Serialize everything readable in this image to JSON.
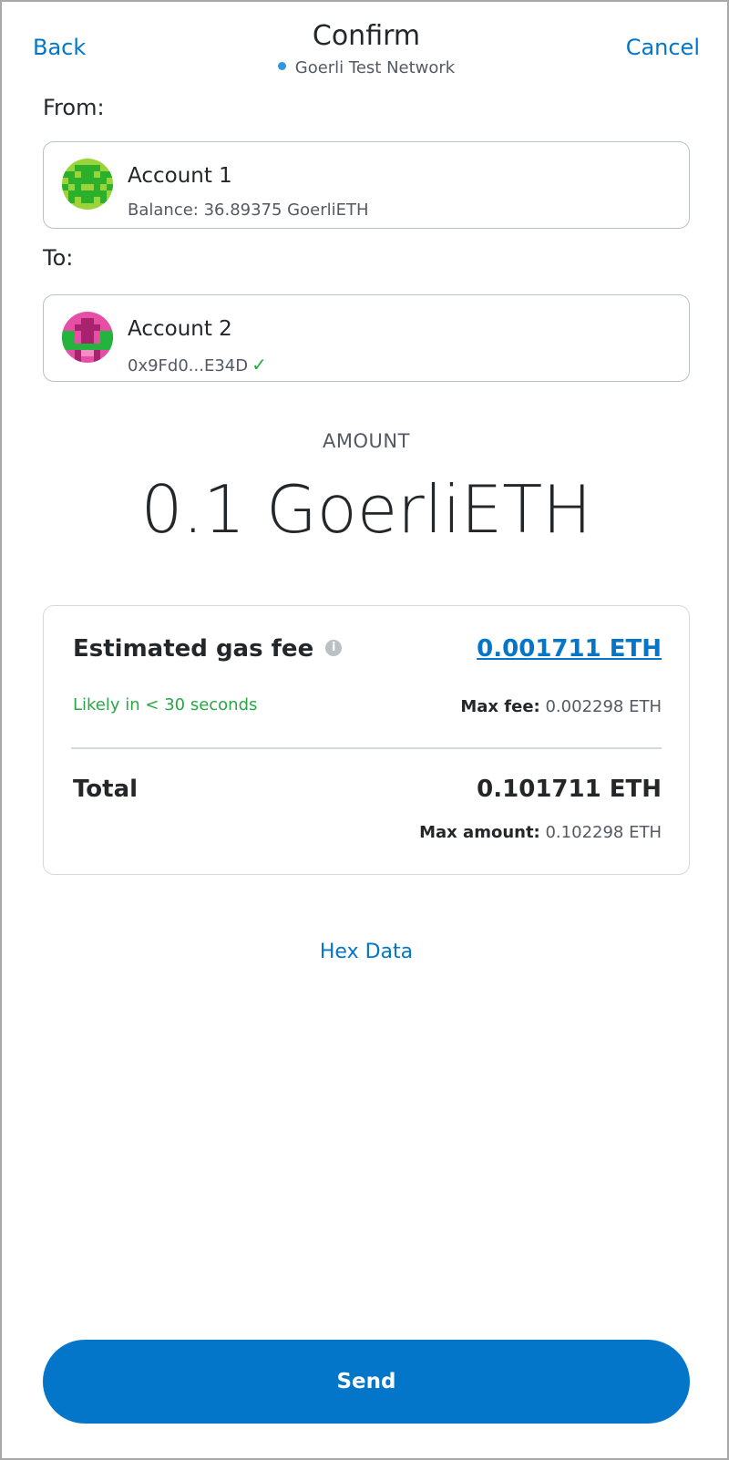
{
  "header": {
    "back_label": "Back",
    "title": "Confirm",
    "network": "Goerli Test Network",
    "cancel_label": "Cancel",
    "network_dot_color": "#3098dc"
  },
  "from": {
    "label": "From:",
    "account_name": "Account 1",
    "balance": "Balance: 36.89375 GoerliETH",
    "avatar": "identicon-green"
  },
  "to": {
    "label": "To:",
    "account_name": "Account 2",
    "address": "0x9Fd0...E34D",
    "verified_icon": "checkmark-icon",
    "avatar": "identicon-pink"
  },
  "amount": {
    "label": "AMOUNT",
    "value": "0.1 GoerliETH"
  },
  "fee": {
    "gas_label": "Estimated gas fee",
    "gas_value": "0.001711 ETH",
    "likely": "Likely in < 30 seconds",
    "max_fee_label": "Max fee:",
    "max_fee_value": "0.002298 ETH",
    "total_label": "Total",
    "total_value": "0.101711 ETH",
    "max_amount_label": "Max amount:",
    "max_amount_value": "0.102298 ETH"
  },
  "hex_data_label": "Hex Data",
  "send_label": "Send",
  "colors": {
    "accent": "#0376c9",
    "success": "#28a745",
    "text": "#24272a",
    "muted": "#535a61"
  }
}
